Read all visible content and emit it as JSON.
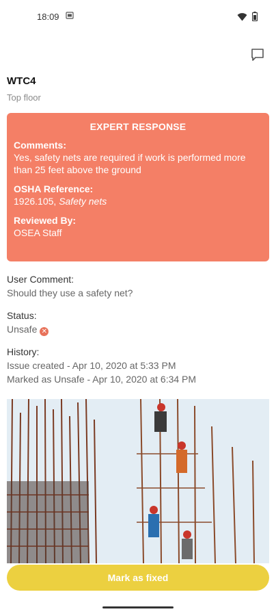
{
  "status_bar": {
    "time": "18:09",
    "sim_icon": "sim-icon",
    "wifi_icon": "wifi-icon",
    "battery_icon": "battery-icon"
  },
  "header": {
    "chat_icon": "chat-bubble-icon"
  },
  "site": {
    "title": "WTC4",
    "subtitle": "Top floor"
  },
  "expert_response": {
    "heading": "EXPERT RESPONSE",
    "comments_label": "Comments:",
    "comments_text": "Yes, safety nets are required if work is performed more than 25 feet above the ground",
    "osha_label": "OSHA Reference:",
    "osha_code": "1926.105,",
    "osha_title": "Safety nets",
    "reviewed_label": "Reviewed By:",
    "reviewed_value": "OSEA Staff",
    "color": "#f47f66"
  },
  "user_comment": {
    "label": "User Comment:",
    "value": "Should they use a safety net?"
  },
  "status": {
    "label": "Status:",
    "value": "Unsafe",
    "badge_icon": "close-circle-icon",
    "badge_color": "#e8725a"
  },
  "history": {
    "label": "History:",
    "entries": [
      "Issue created - Apr 10, 2020 at 5:33 PM",
      "Marked as Unsafe - Apr 10, 2020 at 6:34 PM"
    ]
  },
  "photo": {
    "description_icon": "construction-photo"
  },
  "action": {
    "button_label": "Mark as fixed",
    "button_color": "#ecd040"
  }
}
